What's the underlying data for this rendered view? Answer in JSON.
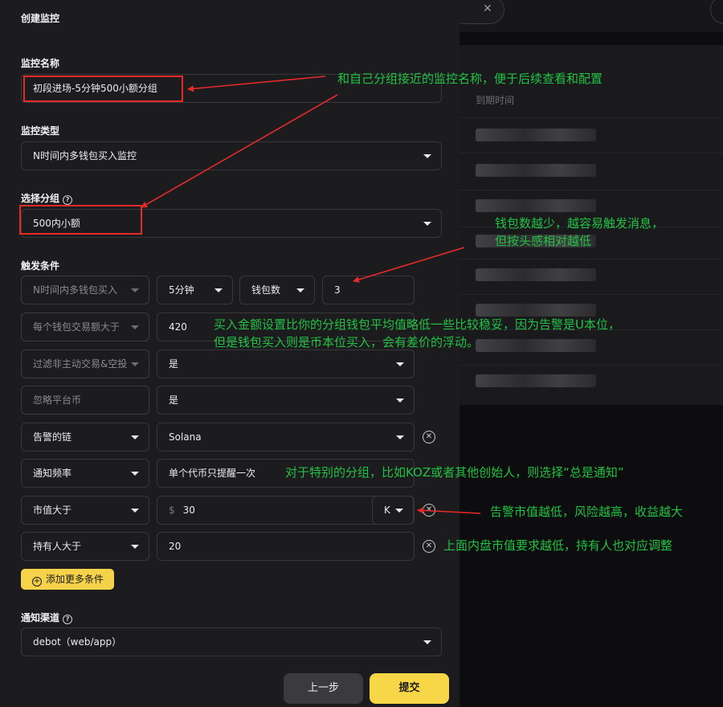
{
  "background": {
    "column_header": "到期时间"
  },
  "modal": {
    "title": "创建监控",
    "name_label": "监控名称",
    "name_value": "初段进场-5分钟500小额分组",
    "type_label": "监控类型",
    "type_value": "N时间内多钱包买入监控",
    "group_label": "选择分组",
    "group_value": "500内小额",
    "conditions_label": "触发条件",
    "conditions": [
      {
        "field": "N时间内多钱包买入",
        "time": "5分钟",
        "metric": "钱包数",
        "value": "3"
      },
      {
        "field": "每个钱包交易额大于",
        "value": "420"
      },
      {
        "field": "过滤非主动交易&空投",
        "value": "是"
      },
      {
        "field": "忽略平台币",
        "value": "是"
      },
      {
        "field": "告警的链",
        "value": "Solana"
      },
      {
        "field": "通知频率",
        "value": "单个代币只提醒一次"
      },
      {
        "field": "市值大于",
        "currency": "$",
        "value": "30",
        "unit": "K"
      },
      {
        "field": "持有人大于",
        "value": "20"
      }
    ],
    "add_condition": "添加更多条件",
    "channel_label": "通知渠道",
    "channel_value": "debot（web/app）",
    "prev_button": "上一步",
    "submit_button": "提交"
  },
  "annotations": {
    "name_tip": "和自己分组接近的监控名称，便于后续查看和配置",
    "wallet_tip_line1": "钱包数越少，越容易触发消息，",
    "wallet_tip_line2": "但按头感相对越低",
    "amount_tip_line1": "买入金额设置比你的分组钱包平均值略低一些比较稳妥，因为告警是U本位，",
    "amount_tip_line2": "但是钱包买入则是币本位买入，会有差价的浮动。",
    "notify_tip": "对于特别的分组，比如KOZ或者其他创始人，则选择“总是通知”",
    "mcap_tip": "告警市值越低，风险越高，收益越大",
    "holder_tip": "上面内盘市值要求越低，持有人也对应调整"
  }
}
